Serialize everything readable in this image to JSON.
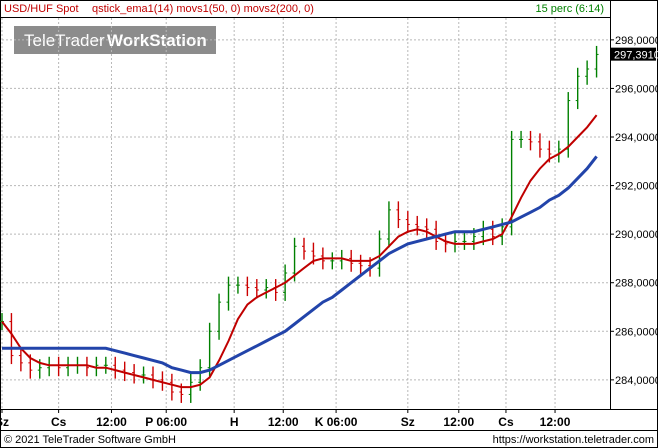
{
  "header": {
    "symbol": "USD/HUF Spot",
    "indicators": "qstick_ema1(14) movs1(50, 0) movs2(200, 0)",
    "interval": "15 perc (6:14)"
  },
  "watermark": {
    "brand_light": "TeleTrader",
    "brand_bold": "WorkStation"
  },
  "footer": {
    "copyright": "© 2021 TeleTrader Software GmbH",
    "url": "https://workstation.teletrader.com"
  },
  "colors": {
    "price_up": "#008000",
    "price_down": "#cc0000",
    "ma50": "#c00000",
    "ma200": "#2244aa",
    "grid": "#b8b8b8",
    "background": "#ffffff",
    "last_price_box": "#000000"
  },
  "chart_data": {
    "type": "line",
    "title": "USD/HUF Spot",
    "y_axis": {
      "side": "right",
      "ylim": [
        282.8,
        298.9
      ],
      "ticks": [
        284,
        286,
        288,
        290,
        292,
        294,
        296,
        298
      ],
      "tick_labels": [
        "284,0000",
        "286,0000",
        "288,0000",
        "290,0000",
        "292,0000",
        "294,0000",
        "296,0000",
        "298,0000"
      ]
    },
    "x_axis": {
      "tick_labels": [
        "Sz",
        "Cs",
        "12:00",
        "P 06:00",
        "H",
        "12:00",
        "K 06:00",
        "Sz",
        "12:00",
        "Cs",
        "12:00"
      ],
      "tick_index": [
        0,
        6,
        11.6,
        17.4,
        24.6,
        29.8,
        35.4,
        43,
        48.4,
        53.4,
        58.6
      ],
      "xlim": [
        0,
        64
      ]
    },
    "grid": true,
    "last_price": 297.391,
    "last_price_label": "297,3910",
    "series": [
      {
        "key": "price",
        "values": [
          286.4,
          285.0,
          284.7,
          284.4,
          284.5,
          284.6,
          284.5,
          284.6,
          284.6,
          284.5,
          284.6,
          284.6,
          284.4,
          284.3,
          284.2,
          284.2,
          284.0,
          283.9,
          283.5,
          283.4,
          283.9,
          284.5,
          286.0,
          287.2,
          287.9,
          287.9,
          287.8,
          287.7,
          287.8,
          287.6,
          288.4,
          289.5,
          289.3,
          289.1,
          288.9,
          288.9,
          289.0,
          288.8,
          288.7,
          288.6,
          289.8,
          291.0,
          290.6,
          290.4,
          290.3,
          290.2,
          289.7,
          289.6,
          289.7,
          289.7,
          289.9,
          290.2,
          289.9,
          290.3,
          293.9,
          293.9,
          293.8,
          293.5,
          293.3,
          293.5,
          295.5,
          296.5,
          296.8,
          297.4
        ]
      },
      {
        "key": "ma50",
        "values": [
          286.4,
          285.9,
          285.3,
          284.9,
          284.7,
          284.6,
          284.6,
          284.6,
          284.6,
          284.6,
          284.5,
          284.5,
          284.4,
          284.3,
          284.2,
          284.1,
          284.0,
          283.9,
          283.8,
          283.7,
          283.7,
          283.8,
          284.1,
          284.8,
          285.6,
          286.5,
          287.1,
          287.4,
          287.6,
          287.8,
          288.0,
          288.3,
          288.6,
          288.9,
          289.0,
          289.0,
          289.0,
          288.9,
          288.9,
          288.9,
          289.1,
          289.5,
          289.9,
          290.1,
          290.2,
          290.1,
          289.9,
          289.7,
          289.6,
          289.6,
          289.6,
          289.7,
          289.8,
          290.0,
          290.7,
          291.5,
          292.2,
          292.7,
          293.1,
          293.3,
          293.6,
          294.0,
          294.4,
          294.9
        ]
      },
      {
        "key": "ma200",
        "values": [
          285.3,
          285.3,
          285.3,
          285.3,
          285.3,
          285.3,
          285.3,
          285.3,
          285.3,
          285.3,
          285.3,
          285.3,
          285.2,
          285.1,
          285.0,
          284.9,
          284.8,
          284.7,
          284.5,
          284.4,
          284.3,
          284.3,
          284.4,
          284.6,
          284.8,
          285.0,
          285.2,
          285.4,
          285.6,
          285.8,
          286.0,
          286.3,
          286.6,
          286.9,
          287.2,
          287.4,
          287.7,
          288.0,
          288.3,
          288.6,
          288.9,
          289.2,
          289.4,
          289.6,
          289.7,
          289.8,
          289.9,
          290.0,
          290.1,
          290.1,
          290.1,
          290.2,
          290.3,
          290.4,
          290.5,
          290.7,
          290.9,
          291.1,
          291.4,
          291.6,
          291.9,
          292.3,
          292.7,
          293.2
        ]
      }
    ]
  }
}
